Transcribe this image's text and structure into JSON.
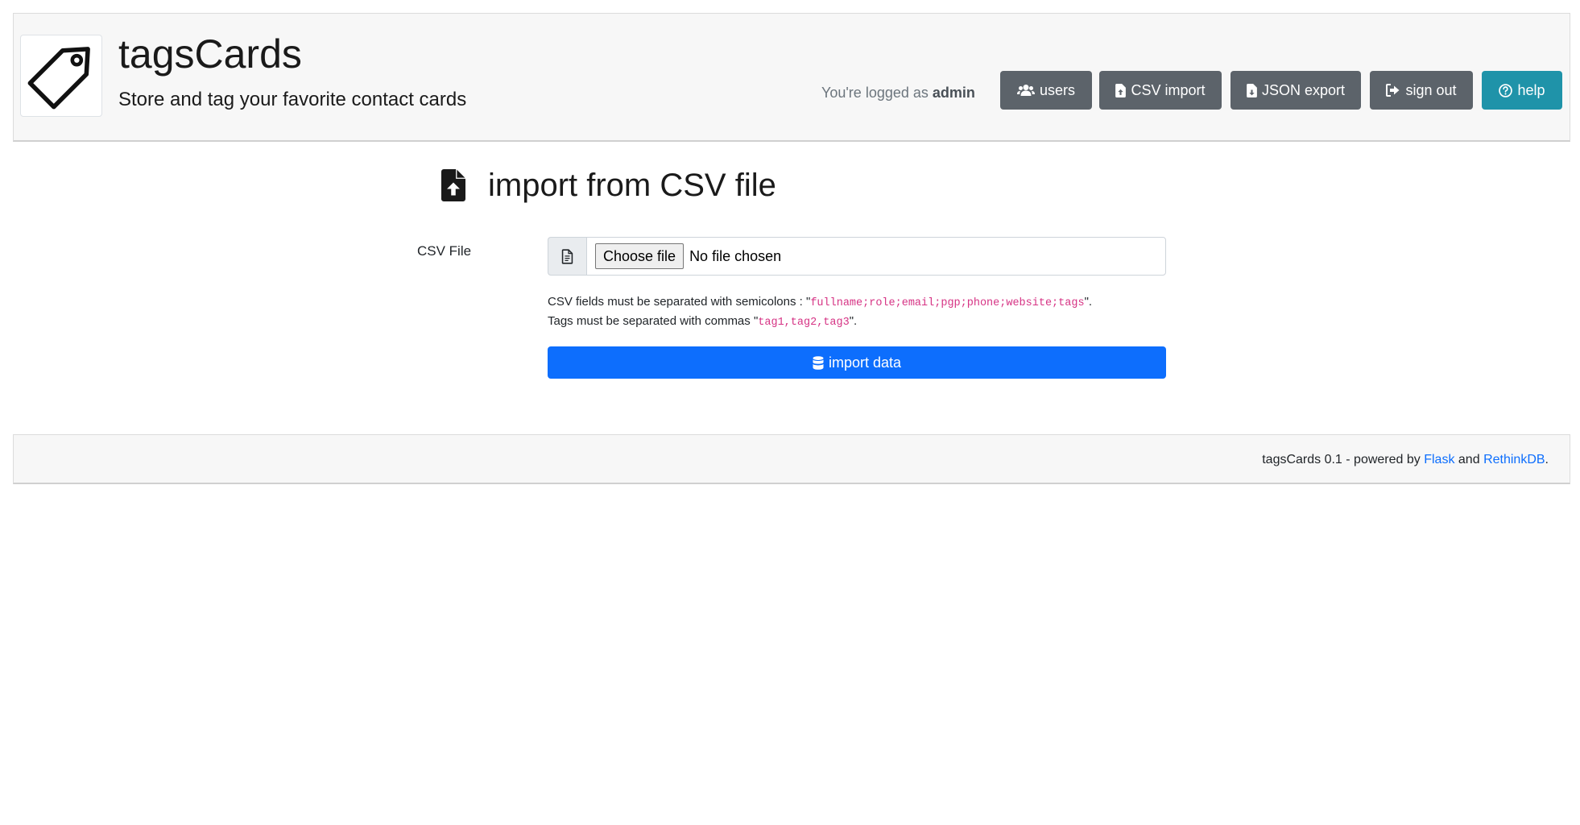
{
  "header": {
    "title": "tagsCards",
    "subtitle": "Store and tag your favorite contact cards",
    "login_prefix": "You're logged as",
    "username": "admin",
    "nav": {
      "users": "users",
      "csv_import": "CSV import",
      "json_export": "JSON export",
      "sign_out": "sign out",
      "help": "help"
    }
  },
  "main": {
    "heading": "import from CSV file",
    "field_label": "CSV File",
    "file_input": {
      "button_label": "Choose file",
      "status": "No file chosen"
    },
    "help_line1": {
      "prefix": "CSV fields must be separated with semicolons : \"",
      "code": "fullname;role;email;pgp;phone;website;tags",
      "suffix": "\"."
    },
    "help_line2": {
      "prefix": "Tags must be separated with commas \"",
      "code": "tag1,tag2,tag3",
      "suffix": "\"."
    },
    "submit_label": "import data"
  },
  "footer": {
    "prefix": "tagsCards 0.1 - powered by",
    "link1": "Flask",
    "middle": "and",
    "link2": "RethinkDB",
    "suffix": "."
  },
  "colors": {
    "primary": "#0d6efd",
    "secondary": "#5c636a",
    "info": "#1f93a9",
    "code": "#d63384"
  },
  "icons": {
    "logo": "tag-icon",
    "users": "users-icon",
    "csv_import": "file-upload-icon",
    "json_export": "file-download-icon",
    "sign_out": "sign-out-icon",
    "help": "question-circle-icon",
    "heading": "file-upload-icon",
    "file_addon": "file-text-icon",
    "submit": "database-icon"
  }
}
